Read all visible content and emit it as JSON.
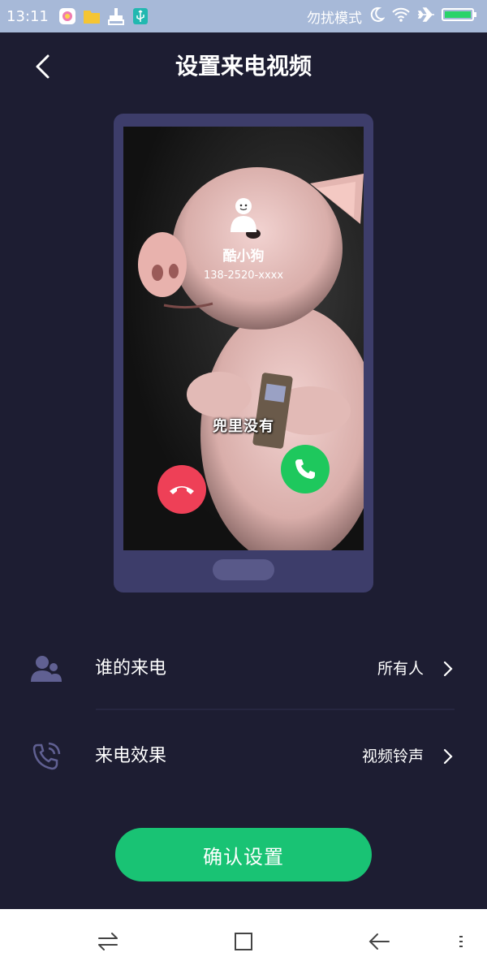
{
  "status_bar": {
    "time": "13:11",
    "dnd_label": "勿扰模式",
    "icons": [
      "app-store-icon",
      "folder-icon",
      "clean-icon",
      "usb-icon",
      "moon-icon",
      "wifi-icon",
      "airplane-icon",
      "battery-icon"
    ]
  },
  "header": {
    "title": "设置来电视频"
  },
  "preview": {
    "contact_name": "酷小狗",
    "contact_number": "138-2520-xxxx",
    "caption": "兜里没有"
  },
  "settings": {
    "rows": [
      {
        "label": "谁的来电",
        "value": "所有人",
        "icon": "contacts-icon"
      },
      {
        "label": "来电效果",
        "value": "视频铃声",
        "icon": "phone-ringing-icon"
      }
    ]
  },
  "confirm_button": {
    "label": "确认设置"
  },
  "colors": {
    "background": "#1d1d32",
    "status_bar": "#a7b9d8",
    "accent_green": "#19c374",
    "hangup_red": "#ee4057",
    "answer_green": "#1ec85d",
    "phone_frame": "#3d3d6a"
  }
}
